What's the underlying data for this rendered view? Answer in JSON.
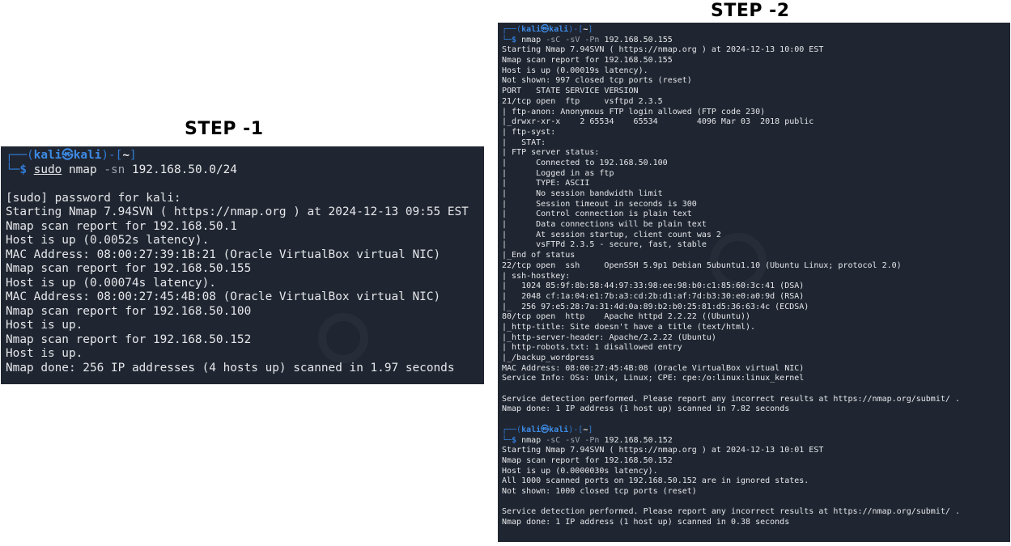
{
  "step1": {
    "title": "STEP -1",
    "prompt": {
      "dec1": "┌──(",
      "user": "kali㉿kali",
      "dec2": ")-[",
      "dir": "~",
      "dec3": "]",
      "dec4": "└─",
      "sym": "$ "
    },
    "command": {
      "sudo": "sudo",
      "name": "nmap",
      "options": "-sn",
      "arg": "192.168.50.0/24"
    },
    "output": [
      "",
      "[sudo] password for kali:",
      "Starting Nmap 7.94SVN ( https://nmap.org ) at 2024-12-13 09:55 EST",
      "Nmap scan report for 192.168.50.1",
      "Host is up (0.0052s latency).",
      "MAC Address: 08:00:27:39:1B:21 (Oracle VirtualBox virtual NIC)",
      "Nmap scan report for 192.168.50.155",
      "Host is up (0.00074s latency).",
      "MAC Address: 08:00:27:45:4B:08 (Oracle VirtualBox virtual NIC)",
      "Nmap scan report for 192.168.50.100",
      "Host is up.",
      "Nmap scan report for 192.168.50.152",
      "Host is up.",
      "Nmap done: 256 IP addresses (4 hosts up) scanned in 1.97 seconds"
    ]
  },
  "step2": {
    "title": "STEP -2",
    "prompt1": {
      "dec1": "┌──(",
      "user": "kali㉿kali",
      "dec2": ")-[",
      "dir": "~",
      "dec3": "]",
      "dec4": "└─",
      "sym": "$ "
    },
    "command1": {
      "name": "nmap",
      "options": "-sC -sV -Pn",
      "arg": "192.168.50.155"
    },
    "output1": [
      "Starting Nmap 7.94SVN ( https://nmap.org ) at 2024-12-13 10:00 EST",
      "Nmap scan report for 192.168.50.155",
      "Host is up (0.00019s latency).",
      "Not shown: 997 closed tcp ports (reset)",
      "PORT   STATE SERVICE VERSION",
      "21/tcp open  ftp     vsftpd 2.3.5",
      "| ftp-anon: Anonymous FTP login allowed (FTP code 230)",
      "|_drwxr-xr-x    2 65534    65534        4096 Mar 03  2018 public",
      "| ftp-syst:",
      "|   STAT:",
      "| FTP server status:",
      "|      Connected to 192.168.50.100",
      "|      Logged in as ftp",
      "|      TYPE: ASCII",
      "|      No session bandwidth limit",
      "|      Session timeout in seconds is 300",
      "|      Control connection is plain text",
      "|      Data connections will be plain text",
      "|      At session startup, client count was 2",
      "|      vsFTPd 2.3.5 - secure, fast, stable",
      "|_End of status",
      "22/tcp open  ssh     OpenSSH 5.9p1 Debian 5ubuntu1.10 (Ubuntu Linux; protocol 2.0)",
      "| ssh-hostkey:",
      "|   1024 85:9f:8b:58:44:97:33:98:ee:98:b0:c1:85:60:3c:41 (DSA)",
      "|   2048 cf:1a:04:e1:7b:a3:cd:2b:d1:af:7d:b3:30:e0:a0:9d (RSA)",
      "|_  256 97:e5:28:7a:31:4d:0a:89:b2:b0:25:81:d5:36:63:4c (ECDSA)",
      "80/tcp open  http    Apache httpd 2.2.22 ((Ubuntu))",
      "|_http-title: Site doesn't have a title (text/html).",
      "|_http-server-header: Apache/2.2.22 (Ubuntu)",
      "| http-robots.txt: 1 disallowed entry",
      "|_/backup_wordpress",
      "MAC Address: 08:00:27:45:4B:08 (Oracle VirtualBox virtual NIC)",
      "Service Info: OSs: Unix, Linux; CPE: cpe:/o:linux:linux_kernel",
      "",
      "Service detection performed. Please report any incorrect results at https://nmap.org/submit/ .",
      "Nmap done: 1 IP address (1 host up) scanned in 7.82 seconds",
      ""
    ],
    "prompt2": {
      "dec1": "┌──(",
      "user": "kali㉿kali",
      "dec2": ")-[",
      "dir": "~",
      "dec3": "]",
      "dec4": "└─",
      "sym": "$ "
    },
    "command2": {
      "name": "nmap",
      "options": "-sC -sV -Pn",
      "arg": "192.168.50.152"
    },
    "output2": [
      "Starting Nmap 7.94SVN ( https://nmap.org ) at 2024-12-13 10:01 EST",
      "Nmap scan report for 192.168.50.152",
      "Host is up (0.0000030s latency).",
      "All 1000 scanned ports on 192.168.50.152 are in ignored states.",
      "Not shown: 1000 closed tcp ports (reset)",
      "",
      "Service detection performed. Please report any incorrect results at https://nmap.org/submit/ .",
      "Nmap done: 1 IP address (1 host up) scanned in 0.38 seconds"
    ]
  }
}
